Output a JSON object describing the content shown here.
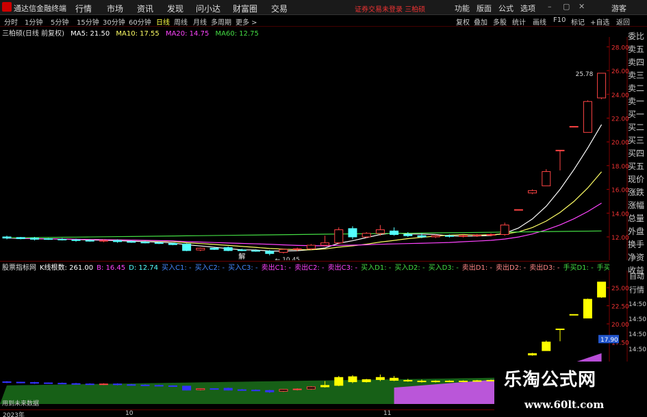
{
  "menubar": {
    "app_title": "通达信金融终端",
    "items": [
      "行情",
      "市场",
      "资讯",
      "发现",
      "问小达",
      "财富圈",
      "交易"
    ],
    "status": "证券交易未登录",
    "stock": "三柏硕",
    "right_items": [
      "功能",
      "版面",
      "公式",
      "选项"
    ],
    "user": "游客"
  },
  "periodbar": {
    "periods": [
      "分时",
      "1分钟",
      "5分钟",
      "15分钟",
      "30分钟",
      "60分钟",
      "日线",
      "周线",
      "月线",
      "多周期",
      "更多 >"
    ],
    "active": "日线",
    "tools": [
      "复权",
      "叠加",
      "多股",
      "统计",
      "画线",
      "F10",
      "标记",
      "+自选",
      "返回"
    ]
  },
  "legend": {
    "title": "三柏硕(日线 前复权)",
    "ma5": "MA5: 21.50",
    "ma10": "MA10: 17.55",
    "ma20": "MA20: 14.75",
    "ma60": "MA60: 12.75"
  },
  "colors": {
    "up": "#ff4444",
    "down": "#54ffff",
    "ma5": "#ffffff",
    "ma10": "#ffff66",
    "ma20": "#ff44ff",
    "ma60": "#44dd44"
  },
  "chart_data": {
    "type": "candlestick",
    "title": "三柏硕(日线 前复权)",
    "y_ticks": [
      12.0,
      14.0,
      16.0,
      18.0,
      20.0,
      22.0,
      24.0,
      26.0,
      28.0
    ],
    "ylim": [
      10.5,
      28.6
    ],
    "high_label": "25.78",
    "low_label": "10.45",
    "low_marker": "解",
    "candles": [
      {
        "o": 12.0,
        "h": 12.1,
        "l": 11.8,
        "c": 11.9
      },
      {
        "o": 11.95,
        "h": 12.0,
        "l": 11.8,
        "c": 11.85
      },
      {
        "o": 11.9,
        "h": 12.0,
        "l": 11.7,
        "c": 11.8
      },
      {
        "o": 11.85,
        "h": 11.9,
        "l": 11.75,
        "c": 11.8
      },
      {
        "o": 11.8,
        "h": 11.9,
        "l": 11.7,
        "c": 11.75
      },
      {
        "o": 11.75,
        "h": 11.85,
        "l": 11.6,
        "c": 11.7
      },
      {
        "o": 11.7,
        "h": 11.8,
        "l": 11.6,
        "c": 11.65
      },
      {
        "o": 11.65,
        "h": 11.8,
        "l": 11.55,
        "c": 11.7
      },
      {
        "o": 11.7,
        "h": 11.8,
        "l": 11.5,
        "c": 11.6
      },
      {
        "o": 11.6,
        "h": 11.7,
        "l": 11.5,
        "c": 11.55
      },
      {
        "o": 11.55,
        "h": 11.65,
        "l": 11.45,
        "c": 11.5
      },
      {
        "o": 11.5,
        "h": 11.6,
        "l": 11.4,
        "c": 11.45
      },
      {
        "o": 11.45,
        "h": 11.5,
        "l": 11.3,
        "c": 11.35
      },
      {
        "o": 11.4,
        "h": 11.45,
        "l": 10.8,
        "c": 10.85
      },
      {
        "o": 10.9,
        "h": 11.1,
        "l": 10.8,
        "c": 11.05
      },
      {
        "o": 11.05,
        "h": 11.1,
        "l": 10.9,
        "c": 10.95
      },
      {
        "o": 11.1,
        "h": 11.2,
        "l": 10.8,
        "c": 10.85
      },
      {
        "o": 10.9,
        "h": 11.0,
        "l": 10.8,
        "c": 10.85
      },
      {
        "o": 10.85,
        "h": 10.95,
        "l": 10.75,
        "c": 10.8
      },
      {
        "o": 10.8,
        "h": 10.9,
        "l": 10.45,
        "c": 10.6
      },
      {
        "o": 10.7,
        "h": 11.0,
        "l": 10.6,
        "c": 10.95
      },
      {
        "o": 10.95,
        "h": 11.1,
        "l": 10.8,
        "c": 11.0
      },
      {
        "o": 11.0,
        "h": 11.4,
        "l": 10.9,
        "c": 11.3
      },
      {
        "o": 11.3,
        "h": 12.1,
        "l": 11.2,
        "c": 11.5
      },
      {
        "o": 11.5,
        "h": 12.8,
        "l": 11.4,
        "c": 12.6
      },
      {
        "o": 12.7,
        "h": 12.9,
        "l": 11.8,
        "c": 12.0
      },
      {
        "o": 12.0,
        "h": 12.4,
        "l": 11.9,
        "c": 12.3
      },
      {
        "o": 12.3,
        "h": 13.0,
        "l": 12.1,
        "c": 12.6
      },
      {
        "o": 12.5,
        "h": 12.8,
        "l": 12.1,
        "c": 12.2
      },
      {
        "o": 12.2,
        "h": 12.4,
        "l": 12.0,
        "c": 12.1
      },
      {
        "o": 12.1,
        "h": 12.3,
        "l": 11.9,
        "c": 12.0
      },
      {
        "o": 12.0,
        "h": 12.2,
        "l": 11.9,
        "c": 12.1
      },
      {
        "o": 12.1,
        "h": 12.2,
        "l": 11.95,
        "c": 12.05
      },
      {
        "o": 12.05,
        "h": 12.2,
        "l": 11.95,
        "c": 12.1
      },
      {
        "o": 12.1,
        "h": 12.25,
        "l": 12.0,
        "c": 12.15
      },
      {
        "o": 12.15,
        "h": 12.3,
        "l": 12.05,
        "c": 12.2
      },
      {
        "o": 12.2,
        "h": 13.2,
        "l": 12.1,
        "c": 13.0
      },
      {
        "o": 14.3,
        "h": 14.3,
        "l": 14.3,
        "c": 14.3
      },
      {
        "o": 15.7,
        "h": 16.0,
        "l": 15.6,
        "c": 15.9
      },
      {
        "o": 16.3,
        "h": 17.7,
        "l": 16.3,
        "c": 17.5
      },
      {
        "o": 19.3,
        "h": 19.3,
        "l": 17.6,
        "c": 19.3
      },
      {
        "o": 21.3,
        "h": 21.3,
        "l": 21.3,
        "c": 21.3
      },
      {
        "o": 20.8,
        "h": 23.5,
        "l": 20.8,
        "c": 23.4
      },
      {
        "o": 23.7,
        "h": 25.78,
        "l": 23.6,
        "c": 25.78
      }
    ]
  },
  "side_labels": [
    "委比",
    "卖五",
    "卖四",
    "卖三",
    "卖二",
    "卖一",
    "买一",
    "买二",
    "买三",
    "买四",
    "买五",
    "现价",
    "涨跌",
    "涨幅",
    "总量",
    "外盘",
    "换手",
    "净资",
    "收益"
  ],
  "indicator": {
    "name": "股票指标网",
    "items": [
      {
        "label": "K线根数: 261.00",
        "color": "#ffffff"
      },
      {
        "label": "B: 16.45",
        "color": "#ff44ff"
      },
      {
        "label": "D: 12.74",
        "color": "#54ffff"
      },
      {
        "label": "买入C1: -",
        "color": "#4488ff"
      },
      {
        "label": "买入C2: -",
        "color": "#4488ff"
      },
      {
        "label": "买入C3: -",
        "color": "#4488ff"
      },
      {
        "label": "卖出C1: -",
        "color": "#ff44ff"
      },
      {
        "label": "卖出C2: -",
        "color": "#ff44ff"
      },
      {
        "label": "卖出C3: -",
        "color": "#ff44ff"
      },
      {
        "label": "买入D1: -",
        "color": "#44dd44"
      },
      {
        "label": "买入D2: -",
        "color": "#44dd44"
      },
      {
        "label": "买入D3: -",
        "color": "#44dd44"
      },
      {
        "label": "卖出D1: -",
        "color": "#ff8888"
      },
      {
        "label": "卖出D2: -",
        "color": "#ff8888"
      },
      {
        "label": "卖出D3: -",
        "color": "#ff8888"
      },
      {
        "label": "手买D1: -",
        "color": "#44dd44"
      },
      {
        "label": "手买D2: -",
        "color": "#44dd44"
      },
      {
        "label": "手买D",
        "color": "#44dd44"
      }
    ],
    "y_ticks": [
      "25.00",
      "22.50",
      "20.00",
      "17.50"
    ],
    "current_label": "17.90",
    "side": [
      "自动",
      "行情"
    ],
    "times": [
      "14:50",
      "14:50",
      "14:50",
      "14:50",
      "14:50",
      "14:50",
      "14:50"
    ],
    "note": "用到未来数据"
  },
  "axis": {
    "year": "2023年",
    "month_10": "10",
    "month_11": "11"
  },
  "watermark": {
    "title": "乐淘公式网",
    "url": "www.60lt.com"
  }
}
